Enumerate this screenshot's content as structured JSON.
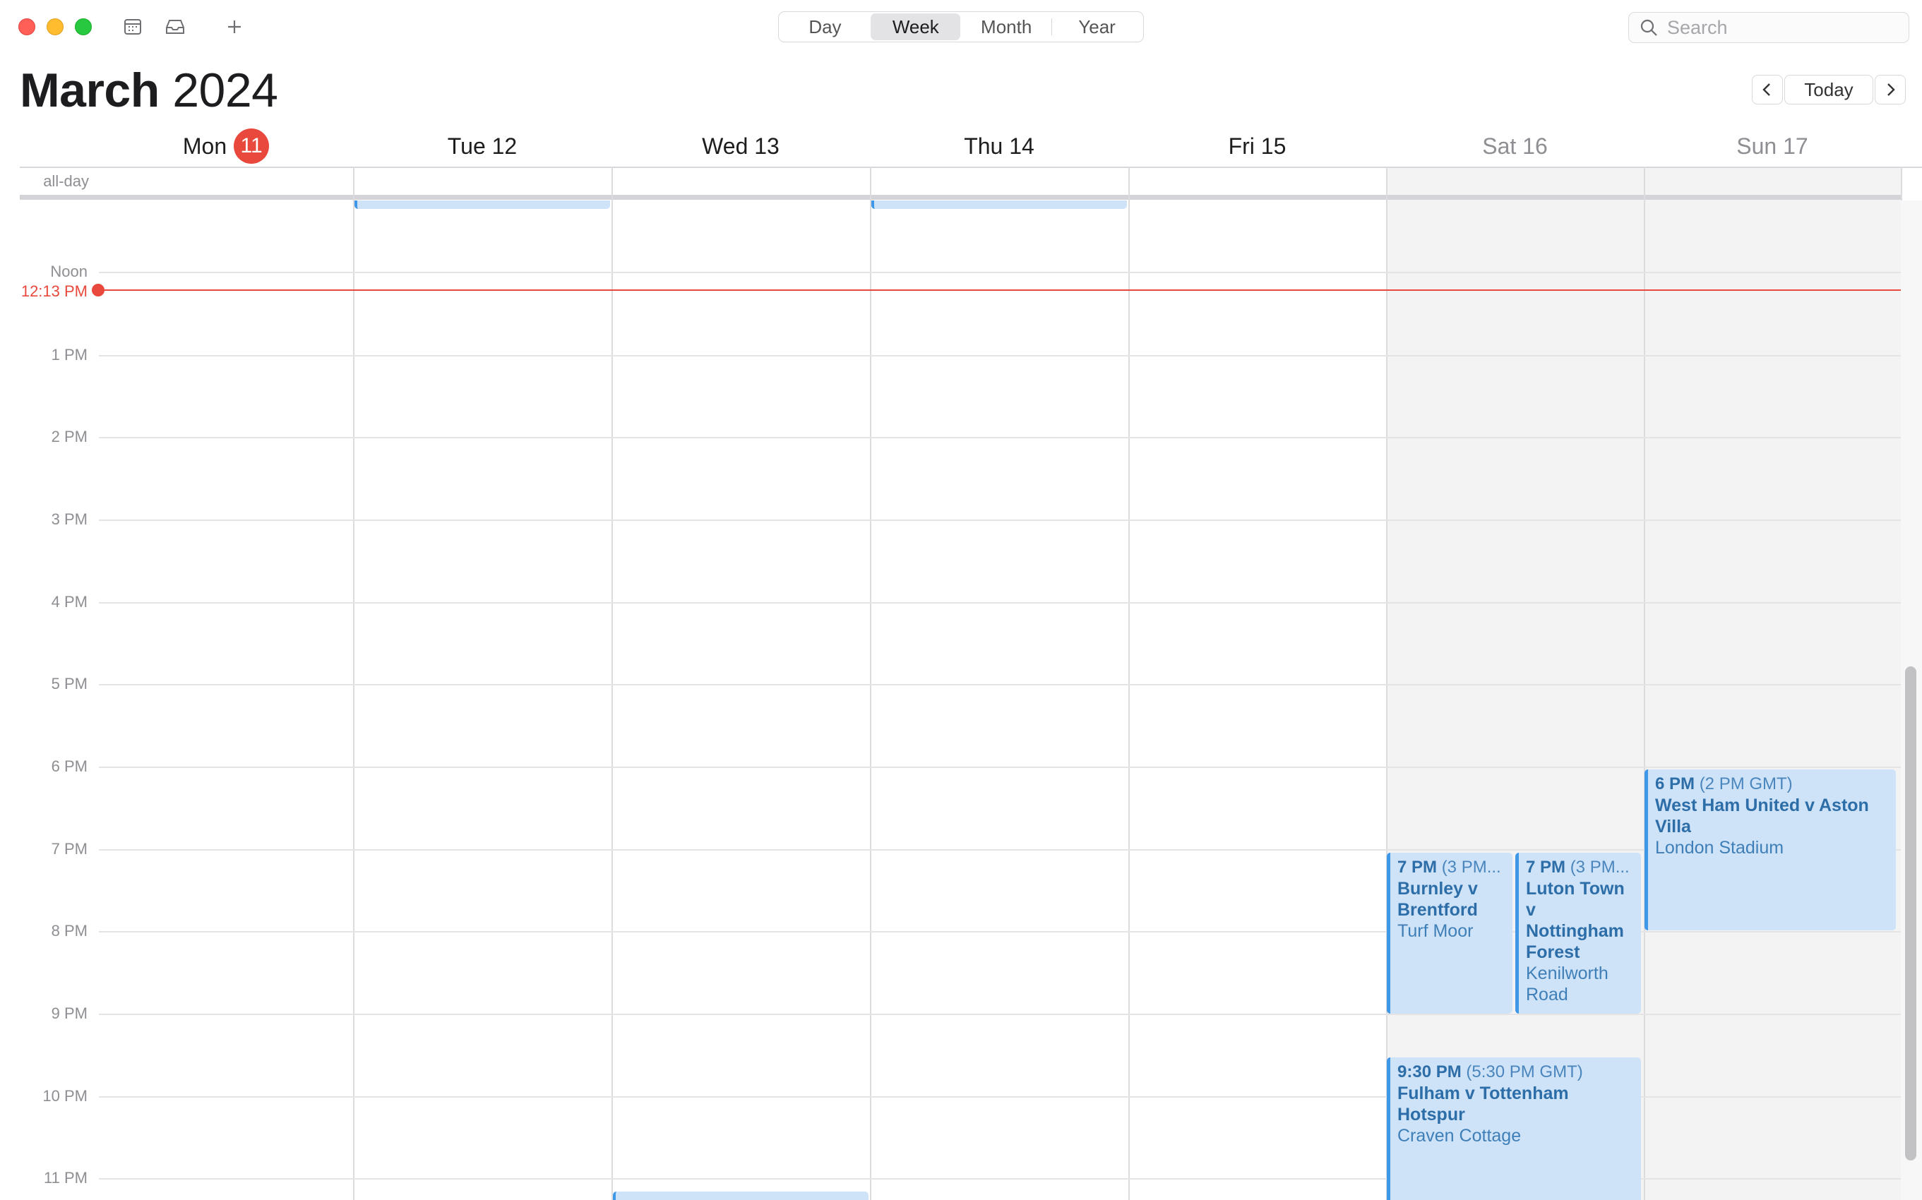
{
  "toolbar": {
    "views": [
      "Day",
      "Week",
      "Month",
      "Year"
    ],
    "active_view": "Week",
    "search_placeholder": "Search",
    "icons": [
      "calendar-list-icon",
      "inbox-icon",
      "plus-icon",
      "search-icon"
    ]
  },
  "header": {
    "month": "March",
    "year": "2024",
    "today_label": "Today"
  },
  "days": [
    {
      "label": "Mon",
      "date": "11",
      "today": true
    },
    {
      "label": "Tue 12"
    },
    {
      "label": "Wed 13"
    },
    {
      "label": "Thu 14"
    },
    {
      "label": "Fri 15"
    },
    {
      "label": "Sat 16",
      "weekend": true
    },
    {
      "label": "Sun 17",
      "weekend": true
    }
  ],
  "allday_label": "all-day",
  "hours": [
    "Noon",
    "1 PM",
    "2 PM",
    "3 PM",
    "4 PM",
    "5 PM",
    "6 PM",
    "7 PM",
    "8 PM",
    "9 PM",
    "10 PM",
    "11 PM"
  ],
  "current_time": "12:13 PM",
  "events": {
    "burnley": {
      "time": "7 PM",
      "alt_time": "(3 PM...",
      "title": "Burnley v Brentford",
      "location": "Turf Moor"
    },
    "luton": {
      "time": "7 PM",
      "alt_time": "(3 PM...",
      "title": "Luton Town v Nottingham Forest",
      "location": "Kenilworth Road"
    },
    "westham": {
      "time": "6 PM",
      "alt_time": "(2 PM GMT)",
      "title": "West Ham United v Aston Villa",
      "location": "London Stadium"
    },
    "fulham": {
      "time": "9:30 PM",
      "alt_time": "(5:30 PM GMT)",
      "title": "Fulham v Tottenham Hotspur",
      "location": "Craven Cottage"
    }
  },
  "colors": {
    "accent_red": "#e8493c",
    "event_fill": "#cfe3f8",
    "event_bar": "#3f97e8",
    "event_text": "#2d6ea8"
  }
}
